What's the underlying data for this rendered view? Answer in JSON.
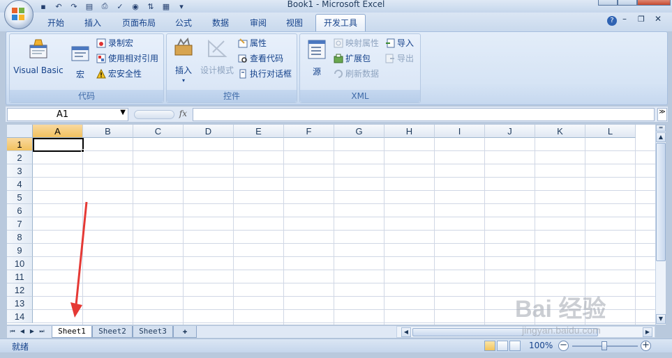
{
  "window": {
    "title": "Book1 - Microsoft Excel"
  },
  "colors": {
    "accent": "#15428b",
    "ribbon_bg": "#dbe6f4",
    "active_header": "#f1c15f",
    "arrow": "#e53935"
  },
  "quick_access": {
    "icons": [
      "save-icon",
      "undo-icon",
      "redo-icon",
      "print-preview-icon",
      "print-icon",
      "spelling-icon",
      "macro-icon",
      "sort-icon",
      "chart-icon",
      "qat-dropdown-icon"
    ]
  },
  "tabs": [
    {
      "label": "开始"
    },
    {
      "label": "插入"
    },
    {
      "label": "页面布局"
    },
    {
      "label": "公式"
    },
    {
      "label": "数据"
    },
    {
      "label": "审阅"
    },
    {
      "label": "视图"
    },
    {
      "label": "开发工具",
      "active": true
    }
  ],
  "ribbon": {
    "code": {
      "title": "代码",
      "visual_basic": "Visual Basic",
      "macros": "宏",
      "record_macro": "录制宏",
      "relative_refs": "使用相对引用",
      "macro_security": "宏安全性"
    },
    "controls": {
      "title": "控件",
      "insert": "插入",
      "design_mode": "设计模式",
      "properties": "属性",
      "view_code": "查看代码",
      "run_dialog": "执行对话框"
    },
    "xml": {
      "title": "XML",
      "source": "源",
      "map_properties": "映射属性",
      "expansion_packs": "扩展包",
      "refresh_data": "刷新数据",
      "import": "导入",
      "export": "导出"
    }
  },
  "formula_bar": {
    "name_box": "A1",
    "fx": "fx",
    "formula": ""
  },
  "grid": {
    "columns": [
      "A",
      "B",
      "C",
      "D",
      "E",
      "F",
      "G",
      "H",
      "I",
      "J",
      "K",
      "L"
    ],
    "rows": [
      "1",
      "2",
      "3",
      "4",
      "5",
      "6",
      "7",
      "8",
      "9",
      "10",
      "11",
      "12",
      "13",
      "14"
    ],
    "active_cell": "A1"
  },
  "sheets": [
    {
      "label": "Sheet1",
      "active": true
    },
    {
      "label": "Sheet2"
    },
    {
      "label": "Sheet3"
    }
  ],
  "status": {
    "text": "就绪",
    "zoom": "100%"
  },
  "watermark": {
    "brand": "Bai  经验",
    "url": "jingyan.baidu.com"
  }
}
